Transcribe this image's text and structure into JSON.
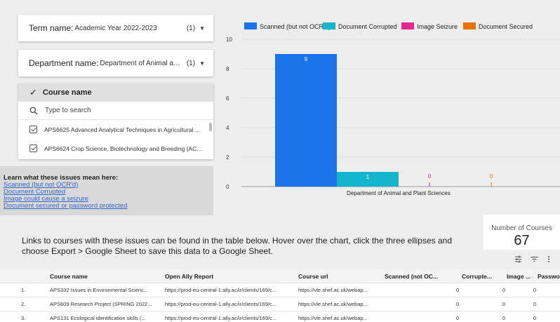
{
  "filters": {
    "term": {
      "label": "Term name",
      "value": "Academic Year 2022-2023",
      "count": "(1)"
    },
    "department": {
      "label": "Department name",
      "value": "Department of Animal and Plant ...",
      "count": "(1)"
    }
  },
  "course_filter": {
    "header": "Course name",
    "search_placeholder": "Type to search",
    "items": [
      "APS6625 Advanced Analytical Techniques in Agricultural ...",
      "APS6624 Crop Science, Biotechnology and Breeding (AC..."
    ]
  },
  "issues_box": {
    "title": "Learn what these issues mean here:",
    "links": [
      "Scanned (but not OCR'd)",
      "Document Corrupted",
      "Image could cause a seizure",
      "Document secured or password protected"
    ]
  },
  "chart_data": {
    "type": "bar",
    "categories": [
      "Department of Animal and Plant Sciences"
    ],
    "series": [
      {
        "name": "Scanned (but not OCR'd)",
        "values": [
          9
        ],
        "color": "#1a73e8"
      },
      {
        "name": "Document Corrupted",
        "values": [
          1
        ],
        "color": "#12b5cb"
      },
      {
        "name": "Image Seizure",
        "values": [
          0
        ],
        "color": "#e52592"
      },
      {
        "name": "Document Secured",
        "values": [
          0
        ],
        "color": "#e8710a"
      }
    ],
    "ylim": [
      0,
      10
    ],
    "yticks": [
      0,
      2,
      4,
      6,
      8,
      10
    ],
    "grid": true,
    "legend": "top"
  },
  "description": "Links to courses with these issues can be found in the table below. Hover over the chart, click the three ellipses and choose Export > Google Sheet to save this data to a Google Sheet.",
  "kpi": {
    "label": "Number of Courses",
    "value": "67"
  },
  "table": {
    "columns": [
      "Course name",
      "Open Ally Report",
      "Course url",
      "Scanned (not OC...",
      "Corrupte...",
      "Image ...",
      "Password..."
    ],
    "rows": [
      {
        "num": "1.",
        "name": "APS332 Issues in Environmental Scienc...",
        "report": "https://prod-eu-central-1.ally.ac/ir/clients/169/c...",
        "url": "https://vle.shef.ac.uk/webap...",
        "scanned": "0",
        "corrupted": "0",
        "image": "0",
        "password": "0"
      },
      {
        "num": "2.",
        "name": "APS609 Research Project (SPRING 2022...",
        "report": "https://prod-eu-central-1.ally.ac/ir/clients/169/c...",
        "url": "https://vle.shef.ac.uk/webap...",
        "scanned": "0",
        "corrupted": "0",
        "image": "0",
        "password": "0"
      },
      {
        "num": "3.",
        "name": "APS131 Ecological identification skills (...",
        "report": "https://prod-eu-central-1.ally.ac/ir/clients/169/c...",
        "url": "https://vle.shef.ac.uk/webap...",
        "scanned": "0",
        "corrupted": "0",
        "image": "0",
        "password": "0"
      }
    ]
  },
  "icons": {
    "tune": "tune-icon",
    "filter": "filter-icon",
    "more": "more-vert-icon"
  }
}
